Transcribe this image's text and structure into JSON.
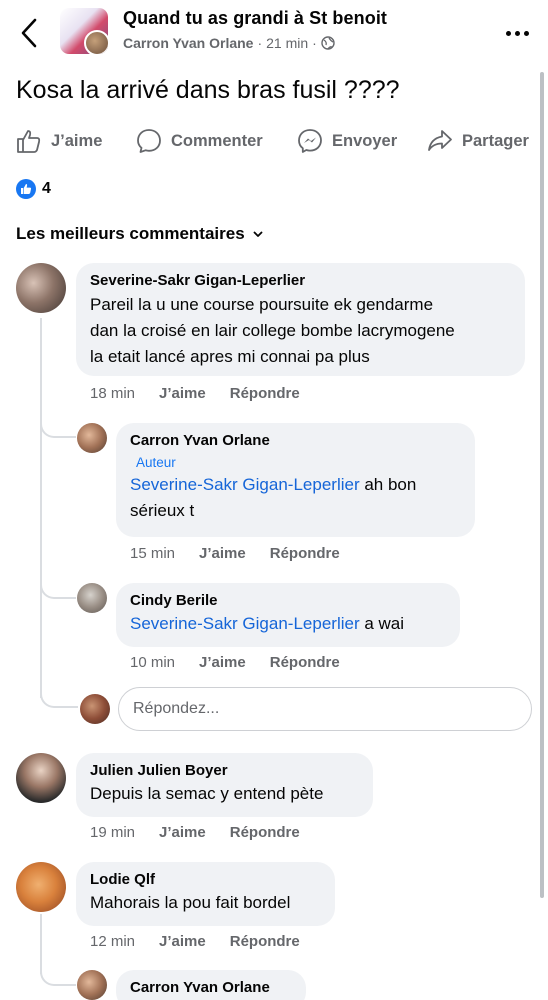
{
  "header": {
    "title": "Quand tu as grandi à St benoit",
    "author": "Carron Yvan Orlane",
    "time": "21 min",
    "separator": "·",
    "privacy_icon": "globe-icon",
    "back_icon": "chevron-left-icon",
    "more_icon": "more-horizontal-icon"
  },
  "post": {
    "text": "Kosa la arrivé dans bras fusil ????"
  },
  "actions": {
    "like": "J’aime",
    "comment": "Commenter",
    "send": "Envoyer",
    "share": "Partager"
  },
  "reactions": {
    "count": "4",
    "icon": "thumbs-up-icon",
    "color": "#1877f2"
  },
  "sort": {
    "label": "Les meilleurs commentaires",
    "icon": "chevron-down-icon"
  },
  "comments": [
    {
      "name": "Severine-Sakr Gigan-Leperlier",
      "lines": [
        "Pareil la u une course poursuite ek gendarme",
        "dan la croisé en lair college bombe lacrymogene",
        "la etait lancé apres mi connai pa plus"
      ],
      "time": "18 min",
      "like": "J’aime",
      "reply": "Répondre"
    },
    {
      "name": "Carron Yvan Orlane",
      "badge": "Auteur",
      "mention": "Severine-Sakr Gigan-Leperlier",
      "text_after": " ah bon",
      "text_line2": "sérieux t",
      "time": "15 min",
      "like": "J’aime",
      "reply": "Répondre"
    },
    {
      "name": "Cindy Berile",
      "mention": "Severine-Sakr Gigan-Leperlier",
      "text_after": " a wai",
      "time": "10 min",
      "like": "J’aime",
      "reply": "Répondre"
    },
    {
      "name": "Julien Julien Boyer",
      "text": "Depuis la semac y entend pète",
      "time": "19 min",
      "like": "J’aime",
      "reply": "Répondre"
    },
    {
      "name": "Lodie Qlf",
      "text": "Mahorais la pou fait bordel",
      "time": "12 min",
      "like": "J’aime",
      "reply": "Répondre"
    },
    {
      "name": "Carron Yvan Orlane"
    }
  ],
  "reply_input": {
    "placeholder": "Répondez..."
  },
  "colors": {
    "accent": "#1877f2",
    "mention": "#1565d8",
    "muted": "#65676b",
    "bubble": "#f0f2f5"
  }
}
